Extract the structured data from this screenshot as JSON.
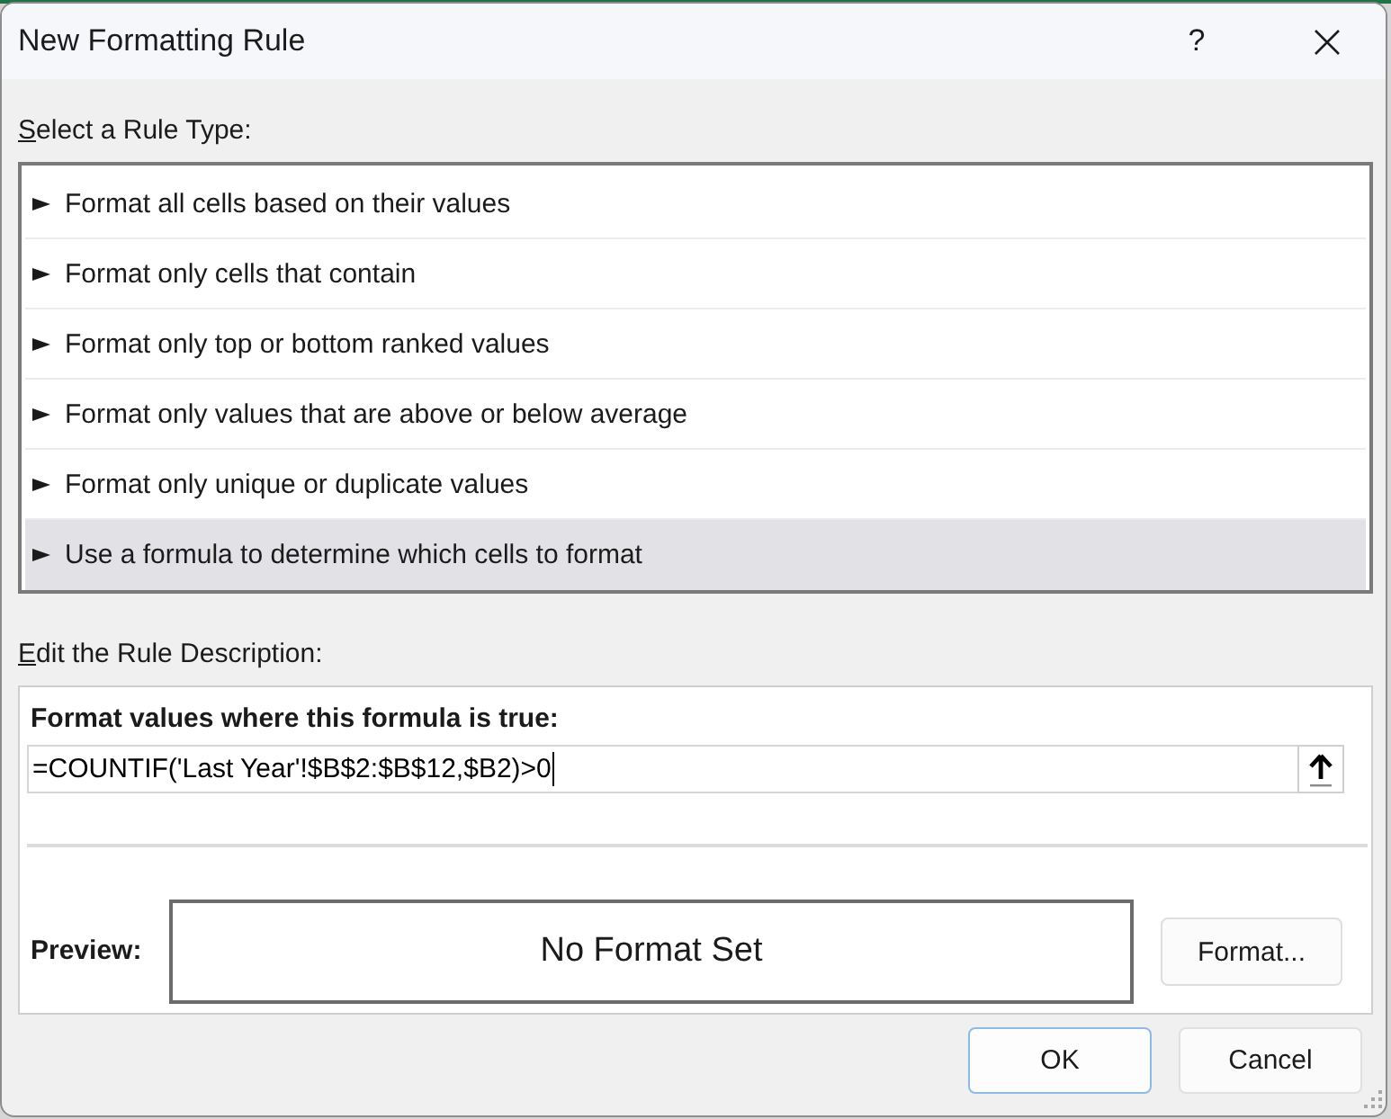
{
  "window": {
    "title": "New Formatting Rule",
    "help": "?"
  },
  "rule_type": {
    "label": "Select a Rule Type:",
    "items": [
      {
        "text": "Format all cells based on their values",
        "selected": false
      },
      {
        "text": "Format only cells that contain",
        "selected": false
      },
      {
        "text": "Format only top or bottom ranked values",
        "selected": false
      },
      {
        "text": "Format only values that are above or below average",
        "selected": false
      },
      {
        "text": "Format only unique or duplicate values",
        "selected": false
      },
      {
        "text": "Use a formula to determine which cells to format",
        "selected": true
      }
    ]
  },
  "rule_description": {
    "label": "Edit the Rule Description:",
    "formula_label": "Format values where this formula is true:",
    "formula": {
      "value": "=COUNTIF('Last Year'!$B$2:$B$12,$B2)>0",
      "focused": true
    },
    "preview_label": "Preview:",
    "preview": "No Format Set",
    "format_button": "Format..."
  },
  "buttons": [
    {
      "label": "OK",
      "default": true
    },
    {
      "label": "Cancel",
      "default": false
    }
  ]
}
